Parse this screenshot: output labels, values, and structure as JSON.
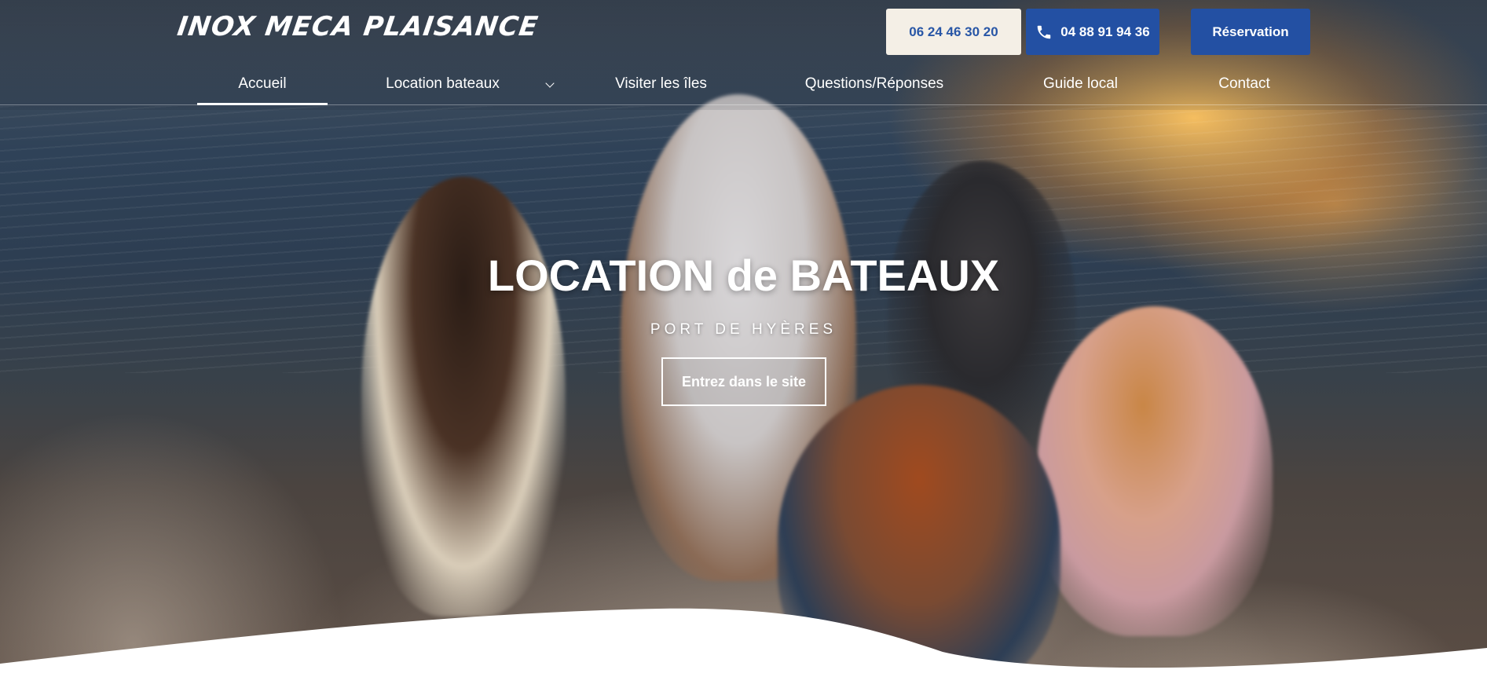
{
  "header": {
    "logo_text": "INOX MECA PLAISANCE",
    "phone_1": "06 24 46 30 20",
    "phone_2": "04 88 91 94 36",
    "reservation_label": "Réservation",
    "phone_icon": "phone-icon"
  },
  "nav": {
    "items": [
      {
        "label": "Accueil",
        "active": true
      },
      {
        "label": "Location bateaux",
        "has_dropdown": true
      },
      {
        "label": "Visiter les îles"
      },
      {
        "label": "Questions/Réponses"
      },
      {
        "label": "Guide local"
      },
      {
        "label": "Contact"
      }
    ]
  },
  "hero": {
    "title": "LOCATION de BATEAUX",
    "subtitle": "PORT DE HYÈRES",
    "cta_label": "Entrez dans le site"
  },
  "colors": {
    "brand_blue": "#2350a3",
    "phone_button_bg": "#f4efe6",
    "text_light": "#ffffff"
  }
}
